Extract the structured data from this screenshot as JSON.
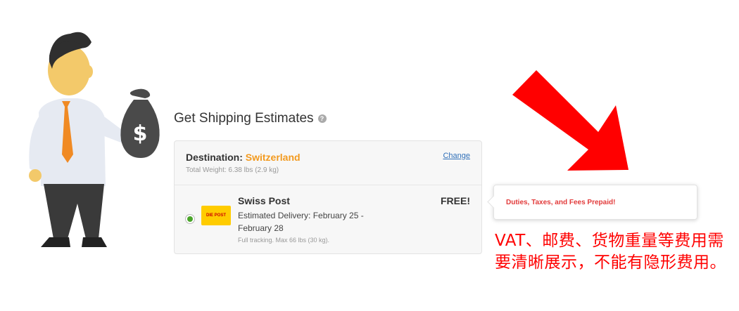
{
  "shipping": {
    "title": "Get Shipping Estimates",
    "help_icon": "question-circle-icon",
    "destination_label": "Destination:",
    "destination_country": "Switzerland",
    "total_weight": "Total Weight: 6.38 lbs (2.9 kg)",
    "change_label": "Change",
    "option": {
      "carrier_logo_text": "DIE POST",
      "carrier": "Swiss Post",
      "delivery": "Estimated Delivery: February 25 - February 28",
      "tracking": "Full tracking. Max 66 lbs (30 kg).",
      "price": "FREE!",
      "selected": true
    }
  },
  "callout": {
    "text": "Duties, Taxes, and Fees Prepaid!"
  },
  "annotation": {
    "text": "VAT、邮费、货物重量等费用需要清晰展示，不能有隐形费用。"
  },
  "colors": {
    "accent_orange": "#f39a1e",
    "link_blue": "#2f6fb8",
    "annotation_red": "#ff0000",
    "radio_green": "#4aa52a"
  },
  "illustration": {
    "figure": "businessman-holding-money-bag",
    "money_icon": "dollar-icon"
  }
}
